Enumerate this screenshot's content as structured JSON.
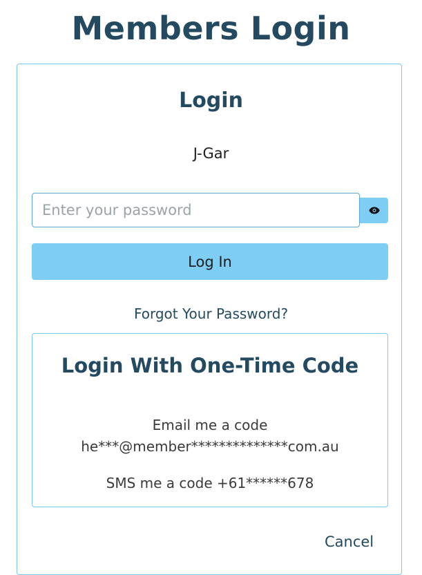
{
  "page": {
    "title": "Members Login"
  },
  "login_card": {
    "title": "Login",
    "username": "J-Gar",
    "password_input": {
      "placeholder": "Enter your password",
      "value": ""
    },
    "show_password_icon": "eye-icon",
    "login_button_label": "Log In",
    "forgot_password_label": "Forgot Your Password?",
    "cancel_label": "Cancel"
  },
  "one_time_code": {
    "title": "Login With One-Time Code",
    "email_label": "Email me a code",
    "email_address": "he***@member**************com.au",
    "sms_label": "SMS me a code +61******678"
  },
  "colors": {
    "heading": "#234a60",
    "accent": "#7ecdf4",
    "border": "#7cc7ee"
  }
}
